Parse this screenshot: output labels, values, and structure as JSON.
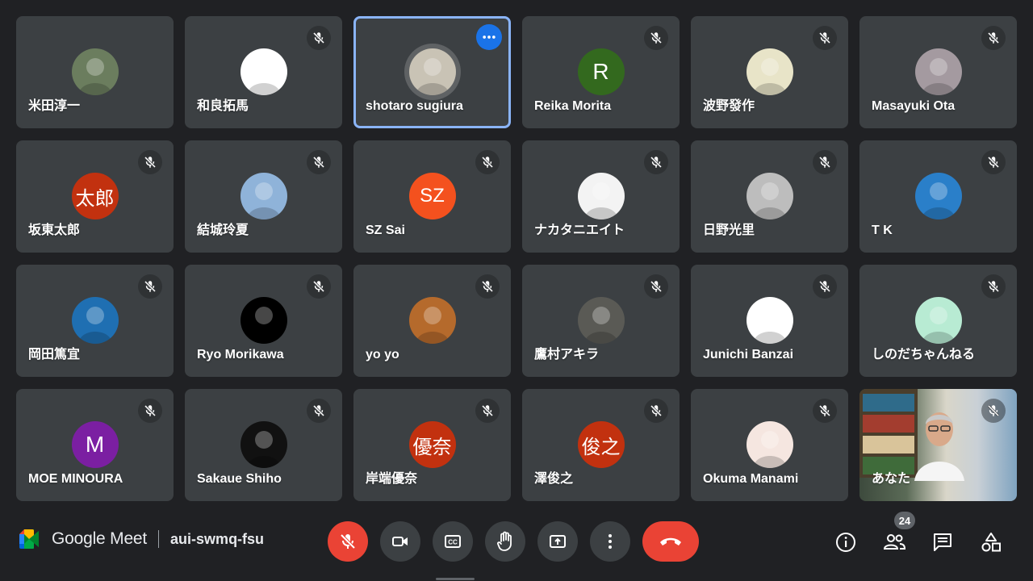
{
  "participants": [
    {
      "name": "米田淳一",
      "avatar": "photo",
      "bg": "#6b7d5e",
      "muted": false
    },
    {
      "name": "和良拓馬",
      "avatar": "photo",
      "bg": "#ffffff",
      "muted": true
    },
    {
      "name": "shotaro sugiura",
      "avatar": "photo",
      "bg": "#c9c3b5",
      "muted": false,
      "active": true,
      "more": true
    },
    {
      "name": "Reika Morita",
      "avatar": "initial",
      "initial": "R",
      "bg": "#33691e",
      "muted": true
    },
    {
      "name": "波野發作",
      "avatar": "photo",
      "bg": "#e8e4c8",
      "muted": true
    },
    {
      "name": "Masayuki Ota",
      "avatar": "photo",
      "bg": "#a49aa0",
      "muted": true
    },
    {
      "name": "坂東太郎",
      "avatar": "initial",
      "initial": "太郎",
      "bg": "#c2310f",
      "muted": true
    },
    {
      "name": "結城玲夏",
      "avatar": "photo",
      "bg": "#8fb3d9",
      "muted": true
    },
    {
      "name": "SZ Sai",
      "avatar": "initial",
      "initial": "SZ",
      "bg": "#f4511e",
      "muted": true
    },
    {
      "name": "ナカタニエイト",
      "avatar": "photo",
      "bg": "#f3f3f3",
      "muted": true
    },
    {
      "name": "日野光里",
      "avatar": "photo",
      "bg": "#bdbdbd",
      "muted": true
    },
    {
      "name": "T K",
      "avatar": "photo",
      "bg": "#2a7fc9",
      "muted": true
    },
    {
      "name": "岡田篤宜",
      "avatar": "photo",
      "bg": "#1f6fb2",
      "muted": true
    },
    {
      "name": "Ryo Morikawa",
      "avatar": "photo",
      "bg": "#000000",
      "muted": true
    },
    {
      "name": "yo yo",
      "avatar": "photo",
      "bg": "#b56a2c",
      "muted": true
    },
    {
      "name": "鷹村アキラ",
      "avatar": "photo",
      "bg": "#5a5a55",
      "muted": true
    },
    {
      "name": "Junichi Banzai",
      "avatar": "photo",
      "bg": "#ffffff",
      "muted": true
    },
    {
      "name": "しのだちゃんねる",
      "avatar": "photo",
      "bg": "#b8ebd3",
      "muted": true
    },
    {
      "name": "MOE MINOURA",
      "avatar": "initial",
      "initial": "M",
      "bg": "#7b1fa2",
      "muted": true
    },
    {
      "name": "Sakaue Shiho",
      "avatar": "photo",
      "bg": "#111111",
      "muted": true
    },
    {
      "name": "岸端優奈",
      "avatar": "initial",
      "initial": "優奈",
      "bg": "#c2310f",
      "muted": true
    },
    {
      "name": "澤俊之",
      "avatar": "initial",
      "initial": "俊之",
      "bg": "#c2310f",
      "muted": true
    },
    {
      "name": "Okuma Manami",
      "avatar": "photo",
      "bg": "#f5e6e0",
      "muted": true
    },
    {
      "name": "あなた",
      "avatar": "video",
      "muted": true,
      "self": true
    }
  ],
  "bottombar": {
    "app_name": "Google Meet",
    "meeting_code": "aui-swmq-fsu",
    "participant_count": "24"
  },
  "colors": {
    "background": "#202124",
    "tile": "#3c4043",
    "red": "#ea4335",
    "accent": "#8ab4f8",
    "more_button": "#1a73e8"
  },
  "icons": {
    "mic": "mic-off-icon",
    "camera": "camera-icon",
    "captions": "captions-icon",
    "hand": "raise-hand-icon",
    "present": "present-icon",
    "more": "more-vert-icon",
    "leave": "call-end-icon",
    "info": "info-icon",
    "people": "people-icon",
    "chat": "chat-icon",
    "activities": "activities-icon"
  }
}
